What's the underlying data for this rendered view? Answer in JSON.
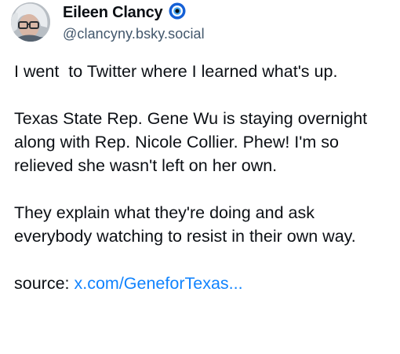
{
  "author": {
    "display_name": "Eileen Clancy",
    "handle": "@clancyny.bsky.social",
    "badge_icon": "evil-eye-icon",
    "badge_colors": {
      "outer": "#1560d6",
      "ring": "#ffffff",
      "iris": "#46a7f0",
      "pupil": "#0b0f14"
    }
  },
  "post": {
    "paragraphs": [
      "I went  to Twitter where I learned what's up.",
      "Texas State Rep. Gene Wu is staying overnight along with Rep. Nicole Collier. Phew! I'm so relieved she wasn't left on her own.",
      "They explain what they're doing and ask everybody watching to resist in their own way."
    ],
    "source_label": "source: ",
    "source_link_text": "x.com/GeneforTexas..."
  },
  "colors": {
    "text": "#0b0f14",
    "secondary_text": "#42576c",
    "link": "#1083fe"
  }
}
